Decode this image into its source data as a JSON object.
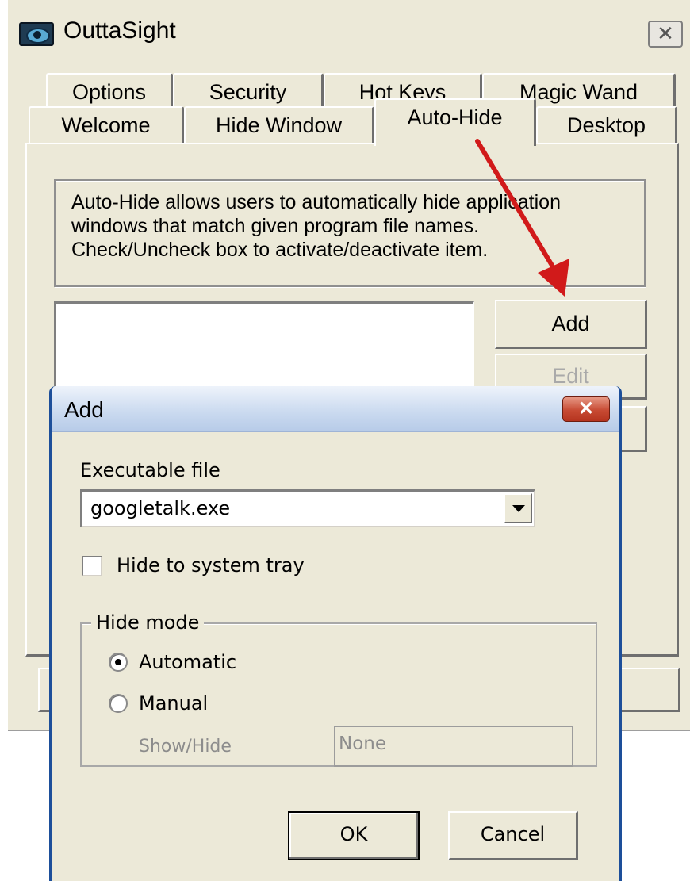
{
  "main_window": {
    "title": "OuttaSight",
    "close_glyph": "✕",
    "tabs_row1": [
      "Options",
      "Security",
      "Hot Keys",
      "Magic Wand"
    ],
    "tabs_row2": [
      "Welcome",
      "Hide Window",
      "Auto-Hide",
      "Desktop"
    ],
    "active_tab": "Auto-Hide",
    "description": "Auto-Hide allows users to automatically hide application\nwindows that match given program file names.\nCheck/Uncheck box to activate/deactivate item.",
    "buttons": {
      "add": "Add",
      "edit": "Edit"
    },
    "annotation_arrow_color": "#d11a1a"
  },
  "add_dialog": {
    "title": "Add",
    "close_glyph": "✕",
    "executable_label": "Executable file",
    "executable_value": "googletalk.exe",
    "hide_to_tray_label": "Hide to system tray",
    "hide_to_tray_checked": false,
    "hide_mode": {
      "legend": "Hide mode",
      "options": [
        "Automatic",
        "Manual"
      ],
      "selected": "Automatic",
      "showhide_label": "Show/Hide",
      "showhide_value": "None"
    },
    "ok_label": "OK",
    "cancel_label": "Cancel"
  }
}
